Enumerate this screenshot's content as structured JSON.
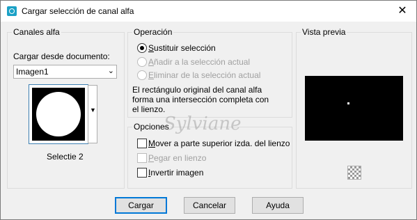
{
  "window": {
    "title": "Cargar selección de canal alfa"
  },
  "canales": {
    "group_title": "Canales alfa",
    "load_label": "Cargar desde documento:",
    "document_value": "Imagen1",
    "channel_name": "Selectie 2"
  },
  "operacion": {
    "group_title": "Operación",
    "options": [
      "Sustituir selección",
      "Añadir a la selección actual",
      "Eliminar de la selección actual"
    ],
    "selected": 0,
    "description": [
      "El rectángulo original del canal alfa",
      "forma una intersección completa con",
      "el lienzo."
    ]
  },
  "opciones": {
    "group_title": "Opciones",
    "items": [
      "Mover a parte superior izda. del lienzo",
      "Pegar en lienzo",
      "Invertir imagen"
    ]
  },
  "preview": {
    "group_title": "Vista previa"
  },
  "watermark": "Sylviane",
  "buttons": {
    "ok": "Cargar",
    "cancel": "Cancelar",
    "help": "Ayuda"
  }
}
